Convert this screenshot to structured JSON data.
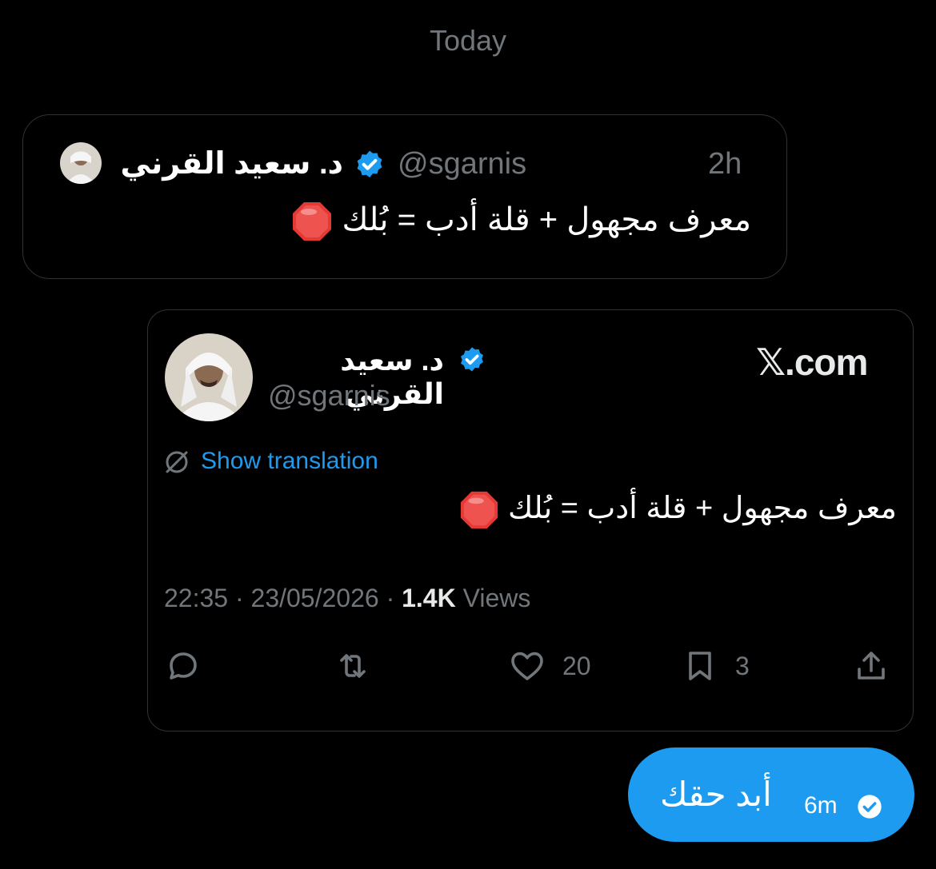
{
  "day_separator": "Today",
  "reply_card": {
    "name": "د. سعيد القرني",
    "handle": "@sgarnis",
    "time": "2h",
    "text": "معرف مجهول + قلة أدب = بُلك",
    "emoji": "stop-sign-emoji"
  },
  "tweet": {
    "name": "د. سعيد القرني",
    "handle": "@sgarnis",
    "brand": "𝕏.com",
    "translate_label": "Show translation",
    "text": "معرف مجهول + قلة أدب = بُلك",
    "emoji": "stop-sign-emoji",
    "timestamp": "22:35 · 23/05/2026 · ",
    "views_count": "1.4K",
    "views_label": " Views",
    "actions": {
      "reply_icon": "reply-icon",
      "retweet_icon": "retweet-icon",
      "like_icon": "heart-icon",
      "like_count": "20",
      "bookmark_icon": "bookmark-icon",
      "bookmark_count": "3",
      "share_icon": "share-icon"
    }
  },
  "message_bubble": {
    "text": "أبد حقك",
    "time": "6m",
    "status_icon": "check-circle-icon"
  },
  "colors": {
    "background": "#000000",
    "accent": "#1d9bf0",
    "muted": "#71767b",
    "border": "#2f3336"
  }
}
